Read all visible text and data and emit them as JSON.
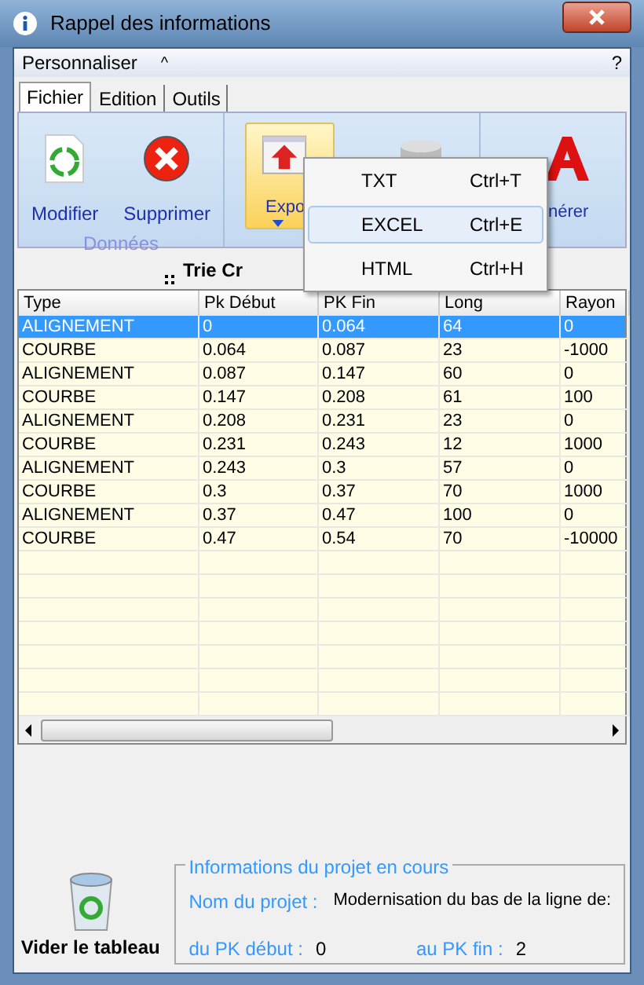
{
  "window": {
    "title": "Rappel des informations"
  },
  "menu_bar": {
    "label": "Personnaliser",
    "collapse": "^",
    "help": "?"
  },
  "tabs": [
    {
      "label": "Fichier",
      "selected": true
    },
    {
      "label": "Edition",
      "selected": false
    },
    {
      "label": "Outils",
      "selected": false
    }
  ],
  "ribbon": {
    "groups": [
      {
        "label": "Données",
        "buttons": [
          {
            "label": "Modifier",
            "highlighted": false
          },
          {
            "label": "Supprimer",
            "highlighted": false
          }
        ]
      },
      {
        "buttons": [
          {
            "label": "Expo",
            "highlighted": true
          },
          {
            "highlighted": false
          }
        ]
      },
      {
        "buttons": [
          {
            "label": "nérer",
            "highlighted": false
          }
        ]
      }
    ]
  },
  "dropdown_menu": [
    {
      "label": "TXT",
      "shortcut": "Ctrl+T",
      "selected": false
    },
    {
      "label": "EXCEL",
      "shortcut": "Ctrl+E",
      "selected": true
    },
    {
      "label": "HTML",
      "shortcut": "Ctrl+H",
      "selected": false
    }
  ],
  "sort_label": "Trie Cr",
  "table": {
    "columns": [
      "Type",
      "Pk Début",
      "PK Fin",
      "Long",
      "Rayon"
    ],
    "rows": [
      {
        "cells": [
          "ALIGNEMENT",
          "0",
          "0.064",
          "64",
          "0"
        ],
        "selected": true
      },
      {
        "cells": [
          "COURBE",
          "0.064",
          "0.087",
          "23",
          "-1000"
        ],
        "selected": false
      },
      {
        "cells": [
          "ALIGNEMENT",
          "0.087",
          "0.147",
          "60",
          "0"
        ],
        "selected": false
      },
      {
        "cells": [
          "COURBE",
          "0.147",
          "0.208",
          "61",
          "100"
        ],
        "selected": false
      },
      {
        "cells": [
          "ALIGNEMENT",
          "0.208",
          "0.231",
          "23",
          "0"
        ],
        "selected": false
      },
      {
        "cells": [
          "COURBE",
          "0.231",
          "0.243",
          "12",
          "1000"
        ],
        "selected": false
      },
      {
        "cells": [
          "ALIGNEMENT",
          "0.243",
          "0.3",
          "57",
          "0"
        ],
        "selected": false
      },
      {
        "cells": [
          "COURBE",
          "0.3",
          "0.37",
          "70",
          "1000"
        ],
        "selected": false
      },
      {
        "cells": [
          "ALIGNEMENT",
          "0.37",
          "0.47",
          "100",
          "0"
        ],
        "selected": false
      },
      {
        "cells": [
          "COURBE",
          "0.47",
          "0.54",
          "70",
          "-10000"
        ],
        "selected": false
      }
    ]
  },
  "clear_button": {
    "label": "Vider le tableau"
  },
  "project_info": {
    "title": "Informations du projet en cours",
    "name_label": "Nom du projet :",
    "name_value": "Modernisation du bas de la ligne de:",
    "start_label": "du PK début :",
    "start_value": "0",
    "end_label": "au PK fin :",
    "end_value": "2"
  }
}
